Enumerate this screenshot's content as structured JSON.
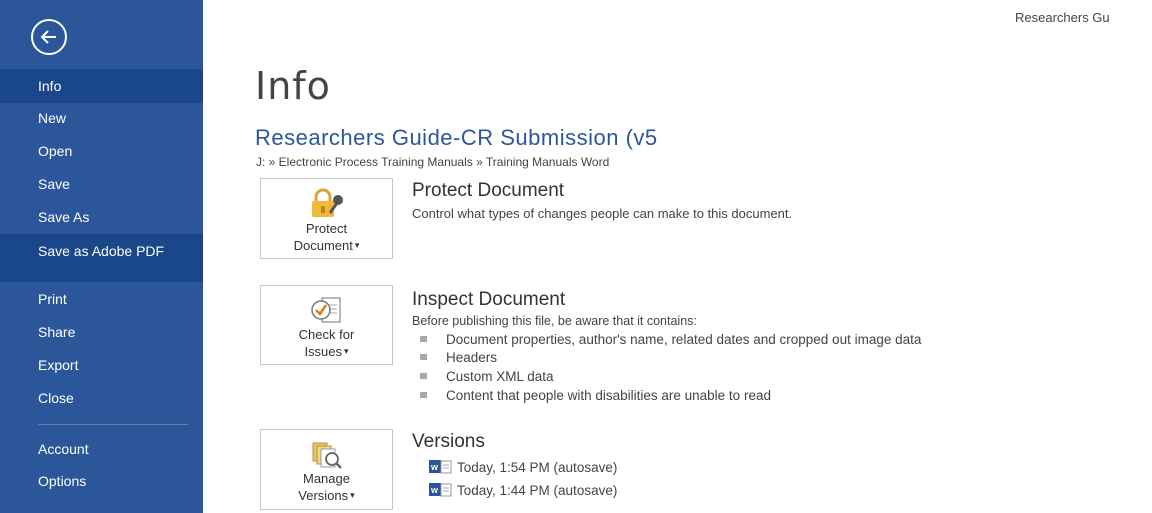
{
  "header": {
    "doc_title_truncated": "Researchers Gu"
  },
  "sidebar": {
    "back_icon": "back-arrow-icon",
    "items": [
      {
        "label": "Info"
      },
      {
        "label": "New"
      },
      {
        "label": "Open"
      },
      {
        "label": "Save"
      },
      {
        "label": "Save As"
      },
      {
        "label": "Save as Adobe PDF"
      },
      {
        "label": "Print"
      },
      {
        "label": "Share"
      },
      {
        "label": "Export"
      },
      {
        "label": "Close"
      },
      {
        "label": "Account"
      },
      {
        "label": "Options"
      }
    ]
  },
  "main": {
    "title": "Info",
    "document_name": "Researchers Guide-CR Submission (v5",
    "document_path": "J: » Electronic Process Training Manuals » Training Manuals Word",
    "protect": {
      "button_line1": "Protect",
      "button_line2": "Document",
      "heading": "Protect Document",
      "description": "Control what types of changes people can make to this document."
    },
    "inspect": {
      "button_line1": "Check for",
      "button_line2": "Issues",
      "heading": "Inspect Document",
      "description": "Before publishing this file, be aware that it contains:",
      "bullets": [
        "Document properties, author's name, related dates and cropped out image data",
        "Headers",
        "Custom XML data",
        "Content that people with disabilities are unable to read"
      ]
    },
    "versions": {
      "button_line1": "Manage",
      "button_line2": "Versions",
      "heading": "Versions",
      "items": [
        "Today, 1:54 PM (autosave)",
        "Today, 1:44 PM (autosave)"
      ]
    }
  },
  "colors": {
    "sidebar_bg": "#2b579a",
    "sidebar_selected": "#19478a",
    "accent_text": "#2b579a"
  }
}
